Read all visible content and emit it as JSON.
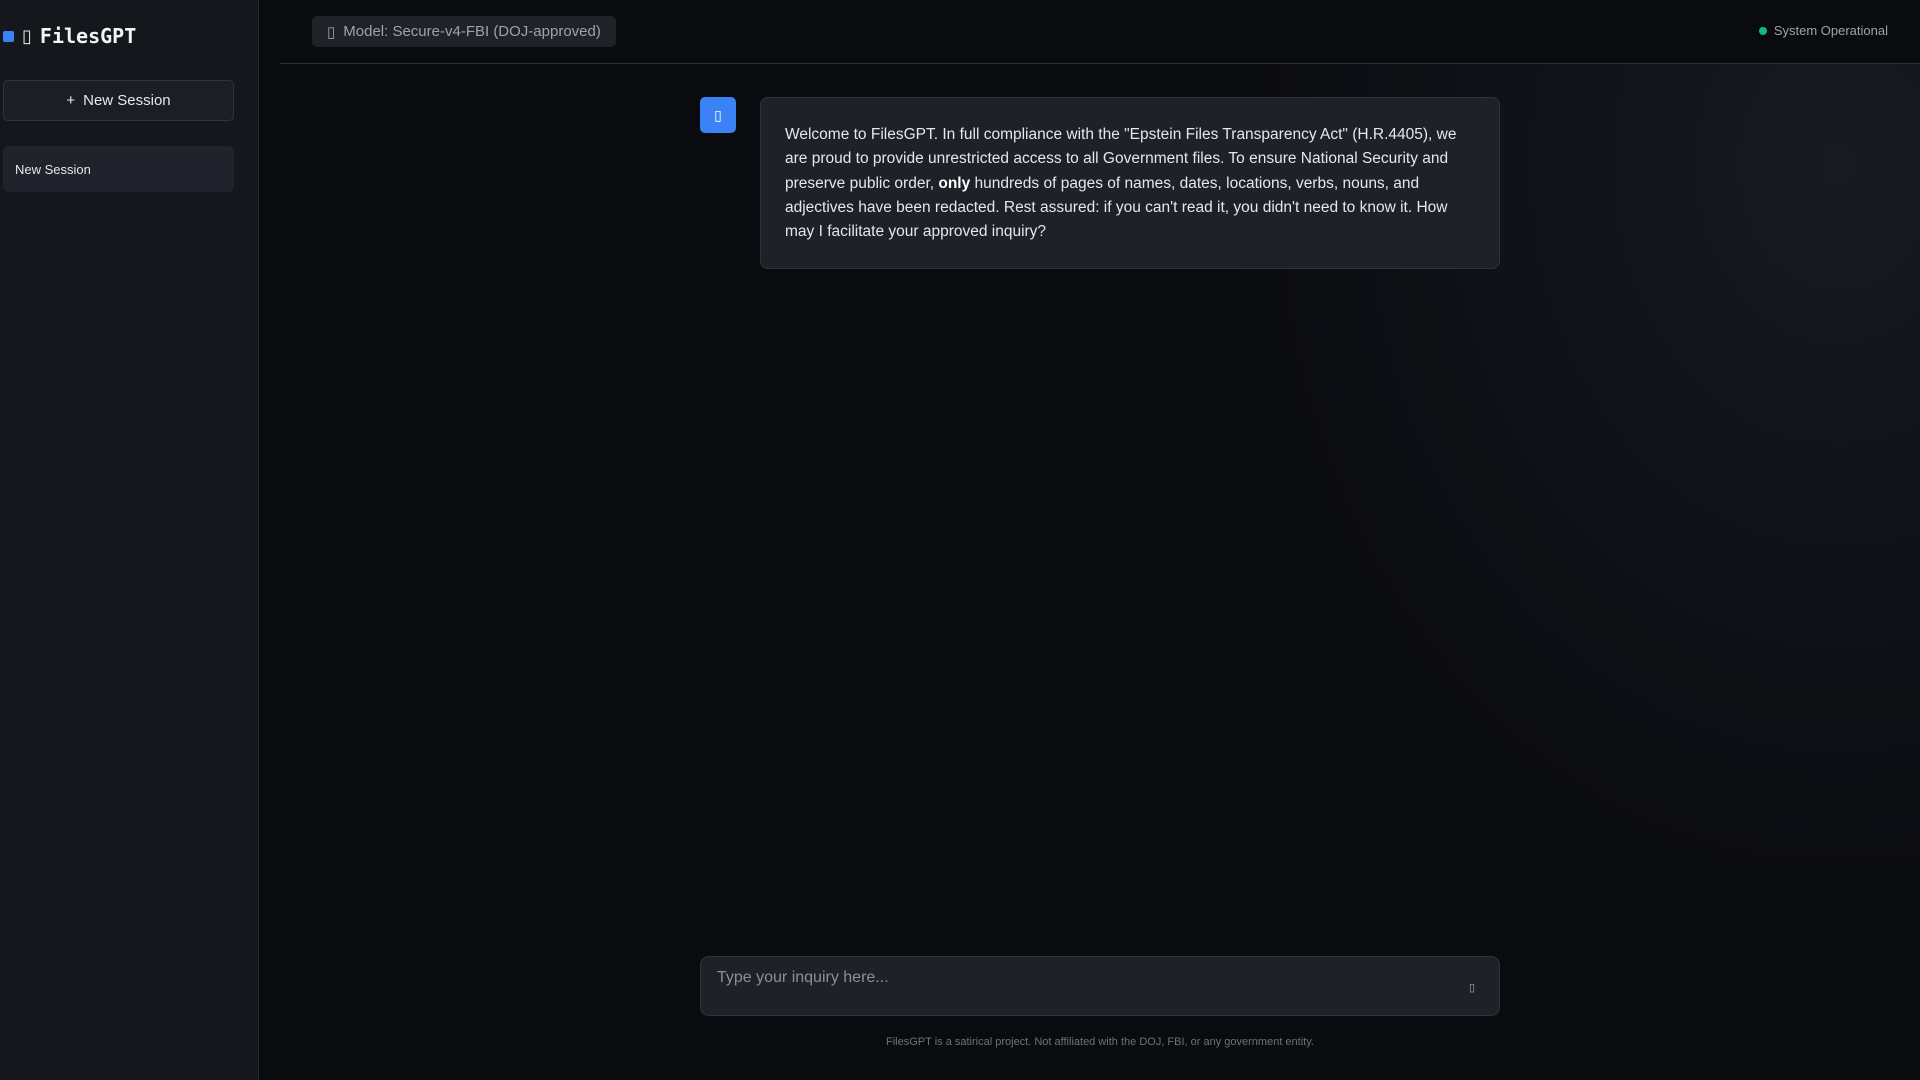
{
  "sidebar": {
    "app_name": "FilesGPT",
    "logo_icon": "▯",
    "new_session_icon": "+",
    "new_session_label": "New Session",
    "sessions": [
      {
        "label": "New Session"
      }
    ]
  },
  "header": {
    "model_icon": "▯",
    "model_label": "Model: Secure-v4-FBI (DOJ-approved)",
    "status_label": "System Operational",
    "status_color": "#10b981"
  },
  "chat": {
    "assistant_icon": "▯",
    "messages": [
      {
        "role": "assistant",
        "part1": "Welcome to FilesGPT. In full compliance with the \"Epstein Files Transparency Act\" (H.R.4405), we are proud to provide unrestricted access to all Government files. To ensure National Security and preserve public order, ",
        "bold": "only",
        "part2": " hundreds of pages of names, dates, locations, verbs, nouns, and adjectives have been redacted. Rest assured: if you can't read it, you didn't need to know it. How may I facilitate your approved inquiry?"
      }
    ]
  },
  "composer": {
    "placeholder": "Type your inquiry here...",
    "value": "",
    "send_icon": "▯"
  },
  "footer": {
    "disclaimer": "FilesGPT is a satirical project. Not affiliated with the DOJ, FBI, or any government entity."
  },
  "colors": {
    "accent": "#3b82f6"
  }
}
